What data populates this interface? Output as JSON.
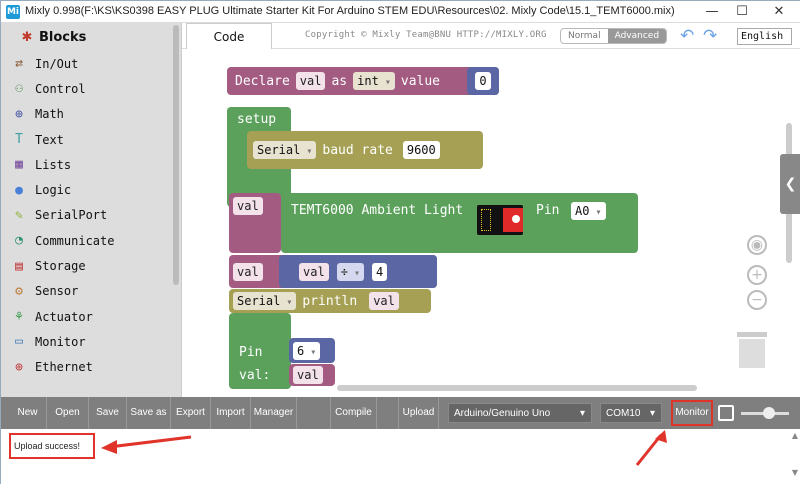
{
  "window": {
    "title": "Mixly 0.998(F:\\KS\\KS0398 EASY PLUG Ultimate Starter Kit For Arduino STEM EDU\\Resources\\02. Mixly Code\\15.1_TEMT6000.mix)",
    "app_icon": "Mi"
  },
  "sidebar": {
    "header": "Blocks",
    "items": [
      {
        "label": "In/Out",
        "icon": "in-out-icon",
        "color": "#8a5e3c"
      },
      {
        "label": "Control",
        "icon": "gamepad-icon",
        "color": "#4c8d4c"
      },
      {
        "label": "Math",
        "icon": "math-icon",
        "color": "#4a5aa8"
      },
      {
        "label": "Text",
        "icon": "text-icon",
        "color": "#3aa0a0"
      },
      {
        "label": "Lists",
        "icon": "lists-icon",
        "color": "#7b4fa0"
      },
      {
        "label": "Logic",
        "icon": "bulb-icon",
        "color": "#4a7fd8"
      },
      {
        "label": "SerialPort",
        "icon": "serial-icon",
        "color": "#8db03c"
      },
      {
        "label": "Communicate",
        "icon": "communicate-icon",
        "color": "#2f8f6e"
      },
      {
        "label": "Storage",
        "icon": "storage-icon",
        "color": "#c23b3b"
      },
      {
        "label": "Sensor",
        "icon": "sensor-icon",
        "color": "#c08040"
      },
      {
        "label": "Actuator",
        "icon": "actuator-icon",
        "color": "#3a9a4a"
      },
      {
        "label": "Monitor",
        "icon": "monitor-icon",
        "color": "#3a7ab8"
      },
      {
        "label": "Ethernet",
        "icon": "ethernet-icon",
        "color": "#c04040"
      }
    ]
  },
  "tabs": {
    "code": "Code",
    "copyright": "Copyright © Mixly Team@BNU HTTP://MIXLY.ORG",
    "mode_normal": "Normal",
    "mode_advanced": "Advanced",
    "language": "English"
  },
  "blocks": {
    "declare": {
      "kw": "Declare",
      "var": "val",
      "as": "as",
      "type": "int",
      "value_kw": "value",
      "value": "0"
    },
    "setup": {
      "kw": "setup",
      "serial": "Serial",
      "baud_kw": "baud rate",
      "baud": "9600"
    },
    "temt": {
      "var": "val",
      "label": "TEMT6000 Ambient Light",
      "pin_kw": "Pin",
      "pin": "A0"
    },
    "divide": {
      "var": "val",
      "var2": "val",
      "op": "÷",
      "value": "4"
    },
    "println": {
      "serial": "Serial",
      "kw": "println",
      "var": "val"
    },
    "write": {
      "pin_kw": "Pin",
      "pin": "6",
      "val_kw": "val:",
      "var": "val"
    }
  },
  "toolbar": {
    "new": "New",
    "open": "Open",
    "save": "Save",
    "save_as": "Save as",
    "export": "Export",
    "import": "Import",
    "manager": "Manager",
    "compile": "Compile",
    "upload": "Upload",
    "board": "Arduino/Genuino Uno",
    "port": "COM10",
    "monitor": "Monitor"
  },
  "output": {
    "status": "Upload success!"
  },
  "colors": {
    "accent_red": "#e0342a",
    "toolbar": "#7f7f7f",
    "var_block": "#a35b82",
    "setup_block": "#5ba15c",
    "serial_block": "#a5a053",
    "math_block": "#5b67a5"
  }
}
